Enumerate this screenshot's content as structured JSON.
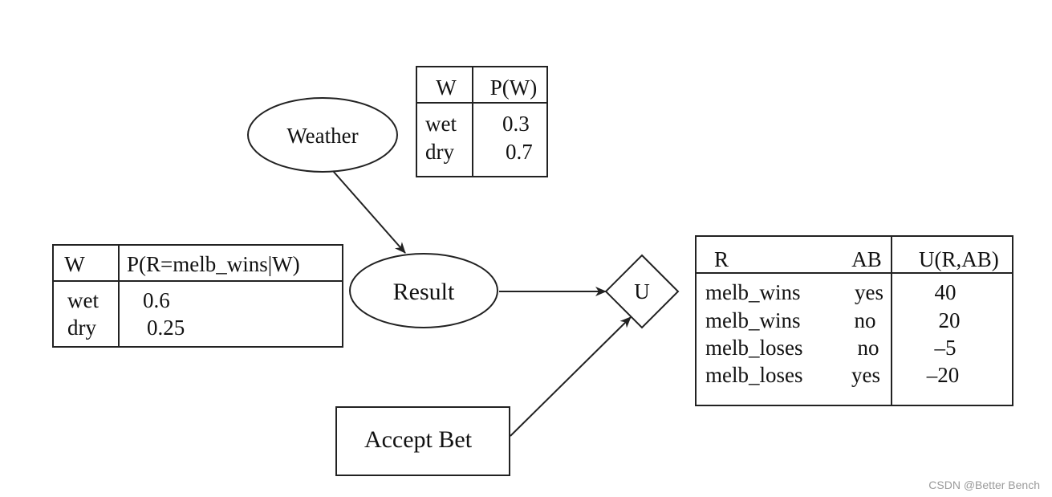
{
  "nodes": {
    "weather": "Weather",
    "result": "Result",
    "utility": "U",
    "accept_bet": "Accept Bet"
  },
  "weather_table": {
    "headers": [
      "W",
      "P(W)"
    ],
    "rows": [
      [
        "wet",
        "0.3"
      ],
      [
        "dry",
        "0.7"
      ]
    ]
  },
  "result_table": {
    "headers": [
      "W",
      "P(R=melb_wins|W)"
    ],
    "rows": [
      [
        "wet",
        "0.6"
      ],
      [
        "dry",
        "0.25"
      ]
    ]
  },
  "utility_table": {
    "headers": [
      "R",
      "AB",
      "U(R,AB)"
    ],
    "rows": [
      [
        "melb_wins",
        "yes",
        "40"
      ],
      [
        "melb_wins",
        "no",
        "20"
      ],
      [
        "melb_loses",
        "no",
        "–5"
      ],
      [
        "melb_loses",
        "yes",
        "–20"
      ]
    ]
  },
  "watermark": "CSDN @Better Bench"
}
